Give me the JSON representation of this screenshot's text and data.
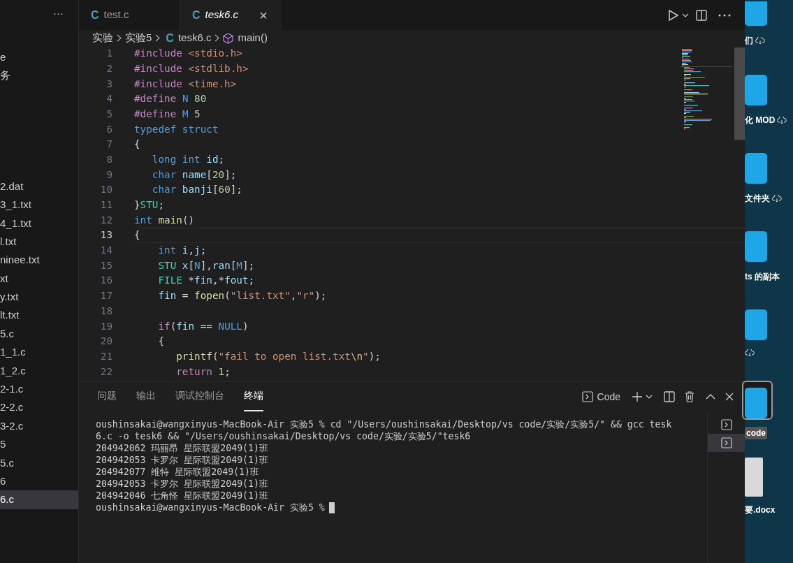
{
  "sidebar": {
    "more": "···",
    "top_items": [
      {
        "label": "e",
        "selected": false
      },
      {
        "label": "务",
        "selected": false
      }
    ],
    "files": [
      {
        "label": "2.dat",
        "selected": false
      },
      {
        "label": "3_1.txt",
        "selected": false
      },
      {
        "label": "4_1.txt",
        "selected": false
      },
      {
        "label": "l.txt",
        "selected": false
      },
      {
        "label": "ninee.txt",
        "selected": false
      },
      {
        "label": "xt",
        "selected": false
      },
      {
        "label": "y.txt",
        "selected": false
      },
      {
        "label": "lt.txt",
        "selected": false
      },
      {
        "label": "5.c",
        "selected": false
      },
      {
        "label": "1_1.c",
        "selected": false
      },
      {
        "label": "1_2.c",
        "selected": false
      },
      {
        "label": "2-1.c",
        "selected": false
      },
      {
        "label": "2-2.c",
        "selected": false
      },
      {
        "label": "3-2.c",
        "selected": false
      },
      {
        "label": "5",
        "selected": false
      },
      {
        "label": "5.c",
        "selected": false
      },
      {
        "label": "6",
        "selected": false
      },
      {
        "label": "6.c",
        "selected": true
      }
    ]
  },
  "tabs": [
    {
      "icon": "C",
      "label": "test.c",
      "selected": false
    },
    {
      "icon": "C",
      "label": "tesk6.c",
      "selected": true,
      "close": "×"
    }
  ],
  "breadcrumb": [
    {
      "kind": "folder",
      "label": "实验"
    },
    {
      "kind": "folder",
      "label": "实验5"
    },
    {
      "kind": "file",
      "icon": "C",
      "label": "tesk6.c"
    },
    {
      "kind": "symbol",
      "label": "main()"
    }
  ],
  "code": [
    {
      "number": "1",
      "current": false,
      "tokens": [
        {
          "kind": "preproc",
          "text": "#include "
        },
        {
          "kind": "string",
          "text": "<stdio.h>"
        }
      ]
    },
    {
      "number": "2",
      "current": false,
      "tokens": [
        {
          "kind": "preproc",
          "text": "#include "
        },
        {
          "kind": "string",
          "text": "<stdlib.h>"
        }
      ]
    },
    {
      "number": "3",
      "current": false,
      "tokens": [
        {
          "kind": "preproc",
          "text": "#include "
        },
        {
          "kind": "string",
          "text": "<time.h>"
        }
      ]
    },
    {
      "number": "4",
      "current": false,
      "tokens": [
        {
          "kind": "preproc",
          "text": "#define "
        },
        {
          "kind": "macro",
          "text": "N"
        },
        {
          "kind": "number",
          "text": " 80"
        }
      ]
    },
    {
      "number": "5",
      "current": false,
      "tokens": [
        {
          "kind": "preproc",
          "text": "#define "
        },
        {
          "kind": "macro",
          "text": "M"
        },
        {
          "kind": "number",
          "text": " 5"
        }
      ]
    },
    {
      "number": "6",
      "current": false,
      "tokens": [
        {
          "kind": "keyword",
          "text": "typedef struct"
        }
      ]
    },
    {
      "number": "7",
      "current": false,
      "tokens": [
        {
          "kind": "plain",
          "text": "{"
        }
      ]
    },
    {
      "number": "8",
      "current": false,
      "tokens": [
        {
          "kind": "keyword",
          "text": "   long int"
        },
        {
          "kind": "variable",
          "text": " id"
        },
        {
          "kind": "plain",
          "text": ";"
        }
      ]
    },
    {
      "number": "9",
      "current": false,
      "tokens": [
        {
          "kind": "keyword",
          "text": "   char"
        },
        {
          "kind": "variable",
          "text": " name"
        },
        {
          "kind": "plain",
          "text": "["
        },
        {
          "kind": "number",
          "text": "20"
        },
        {
          "kind": "plain",
          "text": "];"
        }
      ]
    },
    {
      "number": "10",
      "current": false,
      "tokens": [
        {
          "kind": "keyword",
          "text": "   char"
        },
        {
          "kind": "variable",
          "text": " banji"
        },
        {
          "kind": "plain",
          "text": "["
        },
        {
          "kind": "number",
          "text": "60"
        },
        {
          "kind": "plain",
          "text": "];"
        }
      ]
    },
    {
      "number": "11",
      "current": false,
      "tokens": [
        {
          "kind": "plain",
          "text": "}"
        },
        {
          "kind": "type",
          "text": "STU"
        },
        {
          "kind": "plain",
          "text": ";"
        }
      ]
    },
    {
      "number": "12",
      "current": false,
      "tokens": [
        {
          "kind": "keyword",
          "text": "int"
        },
        {
          "kind": "function",
          "text": " main"
        },
        {
          "kind": "plain",
          "text": "()"
        }
      ]
    },
    {
      "number": "13",
      "current": true,
      "tokens": [
        {
          "kind": "plain",
          "text": "{"
        }
      ]
    },
    {
      "number": "14",
      "current": false,
      "tokens": [
        {
          "kind": "keyword",
          "text": "    int"
        },
        {
          "kind": "variable",
          "text": " i"
        },
        {
          "kind": "plain",
          "text": ","
        },
        {
          "kind": "variable",
          "text": "j"
        },
        {
          "kind": "plain",
          "text": ";"
        }
      ]
    },
    {
      "number": "15",
      "current": false,
      "tokens": [
        {
          "kind": "type",
          "text": "    STU"
        },
        {
          "kind": "variable",
          "text": " x"
        },
        {
          "kind": "plain",
          "text": "["
        },
        {
          "kind": "macro",
          "text": "N"
        },
        {
          "kind": "plain",
          "text": "],"
        },
        {
          "kind": "variable",
          "text": "ran"
        },
        {
          "kind": "plain",
          "text": "["
        },
        {
          "kind": "macro",
          "text": "M"
        },
        {
          "kind": "plain",
          "text": "];"
        }
      ]
    },
    {
      "number": "16",
      "current": false,
      "tokens": [
        {
          "kind": "type",
          "text": "    FILE"
        },
        {
          "kind": "plain",
          "text": " *"
        },
        {
          "kind": "variable",
          "text": "fin"
        },
        {
          "kind": "plain",
          "text": ",*"
        },
        {
          "kind": "variable",
          "text": "fout"
        },
        {
          "kind": "plain",
          "text": ";"
        }
      ]
    },
    {
      "number": "17",
      "current": false,
      "tokens": [
        {
          "kind": "variable",
          "text": "    fin"
        },
        {
          "kind": "plain",
          "text": " = "
        },
        {
          "kind": "function",
          "text": "fopen"
        },
        {
          "kind": "plain",
          "text": "("
        },
        {
          "kind": "string",
          "text": "\"list.txt\""
        },
        {
          "kind": "plain",
          "text": ","
        },
        {
          "kind": "string",
          "text": "\"r\""
        },
        {
          "kind": "plain",
          "text": ");"
        }
      ]
    },
    {
      "number": "18",
      "current": false
    },
    {
      "number": "19",
      "current": false,
      "tokens": [
        {
          "kind": "control",
          "text": "    if"
        },
        {
          "kind": "plain",
          "text": "("
        },
        {
          "kind": "variable",
          "text": "fin"
        },
        {
          "kind": "plain",
          "text": " == "
        },
        {
          "kind": "macro",
          "text": "NULL"
        },
        {
          "kind": "plain",
          "text": ")"
        }
      ]
    },
    {
      "number": "20",
      "current": false,
      "tokens": [
        {
          "kind": "plain",
          "text": "    {"
        }
      ]
    },
    {
      "number": "21",
      "current": false,
      "tokens": [
        {
          "kind": "function",
          "text": "       printf"
        },
        {
          "kind": "plain",
          "text": "("
        },
        {
          "kind": "string",
          "text": "\"fail to open list.txt"
        },
        {
          "kind": "escape",
          "text": "\\n"
        },
        {
          "kind": "string",
          "text": "\""
        },
        {
          "kind": "plain",
          "text": ");"
        }
      ]
    },
    {
      "number": "22",
      "current": false,
      "tokens": [
        {
          "kind": "control",
          "text": "       return"
        },
        {
          "kind": "number",
          "text": " 1"
        },
        {
          "kind": "plain",
          "text": ";"
        }
      ]
    }
  ],
  "panel": {
    "tabs": [
      {
        "label": "问题",
        "selected": false
      },
      {
        "label": "输出",
        "selected": false
      },
      {
        "label": "调试控制台",
        "selected": false
      },
      {
        "label": "终端",
        "selected": true
      }
    ],
    "terminal_name": "Code",
    "terminal_lines": [
      "oushinsakai@wangxinyus-MacBook-Air 实验5 % cd \"/Users/oushinsakai/Desktop/vs code/实验/实验5/\" && gcc tesk",
      "6.c -o tesk6 && \"/Users/oushinsakai/Desktop/vs code/实验/实验5/\"tesk6",
      "204942062 玛丽昂 星际联盟2049(1)班",
      "204942053 卡罗尔 星际联盟2049(1)班",
      "204942077 维特 星际联盟2049(1)班",
      "204942053 卡罗尔 星际联盟2049(1)班",
      "204942046 七角怪 星际联盟2049(1)班",
      "oushinsakai@wangxinyus-MacBook-Air 实验5 %"
    ],
    "terminals": [
      {
        "selected": false
      },
      {
        "selected": true
      }
    ]
  },
  "desktop": [
    {
      "kind": "folder",
      "label": "们",
      "selected": false,
      "cloud": true
    },
    {
      "kind": "folder",
      "label": "化 MOD",
      "selected": false,
      "cloud": true
    },
    {
      "kind": "folder",
      "label": "文件夹",
      "selected": false,
      "cloud": true
    },
    {
      "kind": "folder",
      "label": "ts 的副本",
      "selected": false,
      "cloud": false
    },
    {
      "kind": "folder",
      "selected": false,
      "cloud": true
    },
    {
      "kind": "folder",
      "label": "code",
      "selected": true,
      "cloud": false
    },
    {
      "kind": "document",
      "label": "要.docx",
      "selected": false,
      "cloud": false
    }
  ]
}
